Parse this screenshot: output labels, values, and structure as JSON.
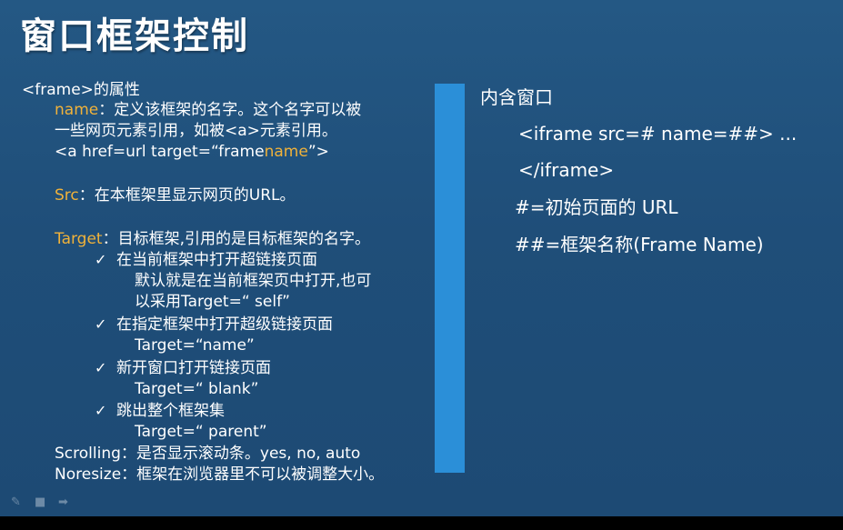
{
  "title": "窗口框架控制",
  "left": {
    "frame_prop": "<frame>的属性",
    "name_key": "name",
    "name_desc1": "：定义该框架的名字。这个名字可以被",
    "name_desc2": "一些网页元素引用，如被<a>元素引用。",
    "anchor_pre": "<a href=url target=“frame",
    "anchor_hl": "name",
    "anchor_post": "”>",
    "src_key": "Src",
    "src_desc": "：在本框架里显示网页的URL。",
    "target_key": "Target",
    "target_desc": "：目标框架,引用的是目标框架的名字。",
    "opt1": "在当前框架中打开超链接页面",
    "opt1_note1": "默认就是在当前框架页中打开,也可",
    "opt1_note2": "以采用Target=“ self”",
    "opt2": "在指定框架中打开超级链接页面",
    "opt2_note": "Target=“name”",
    "opt3": "新开窗口打开链接页面",
    "opt3_note": "Target=“ blank”",
    "opt4": "跳出整个框架集",
    "opt4_note": "Target=“ parent”",
    "scroll_key": "Scrolling",
    "scroll_desc": "：是否显示滚动条。yes, no, auto",
    "noresize_key": "Noresize",
    "noresize_desc": "：框架在浏览器里不可以被调整大小。",
    "check": "✓"
  },
  "right": {
    "heading": "内含窗口",
    "code1": "<iframe src=#  name=##> ...",
    "code2": "</iframe>",
    "note1": "#=初始页面的 URL",
    "note2": "##=框架名称(Frame Name)"
  },
  "controls": {
    "pen_icon": "✎",
    "screen_icon": "■",
    "next_icon": "➡"
  },
  "colors": {
    "background": "#1f4e79",
    "highlight": "#f0b23a",
    "divider": "#2b8fd8"
  }
}
